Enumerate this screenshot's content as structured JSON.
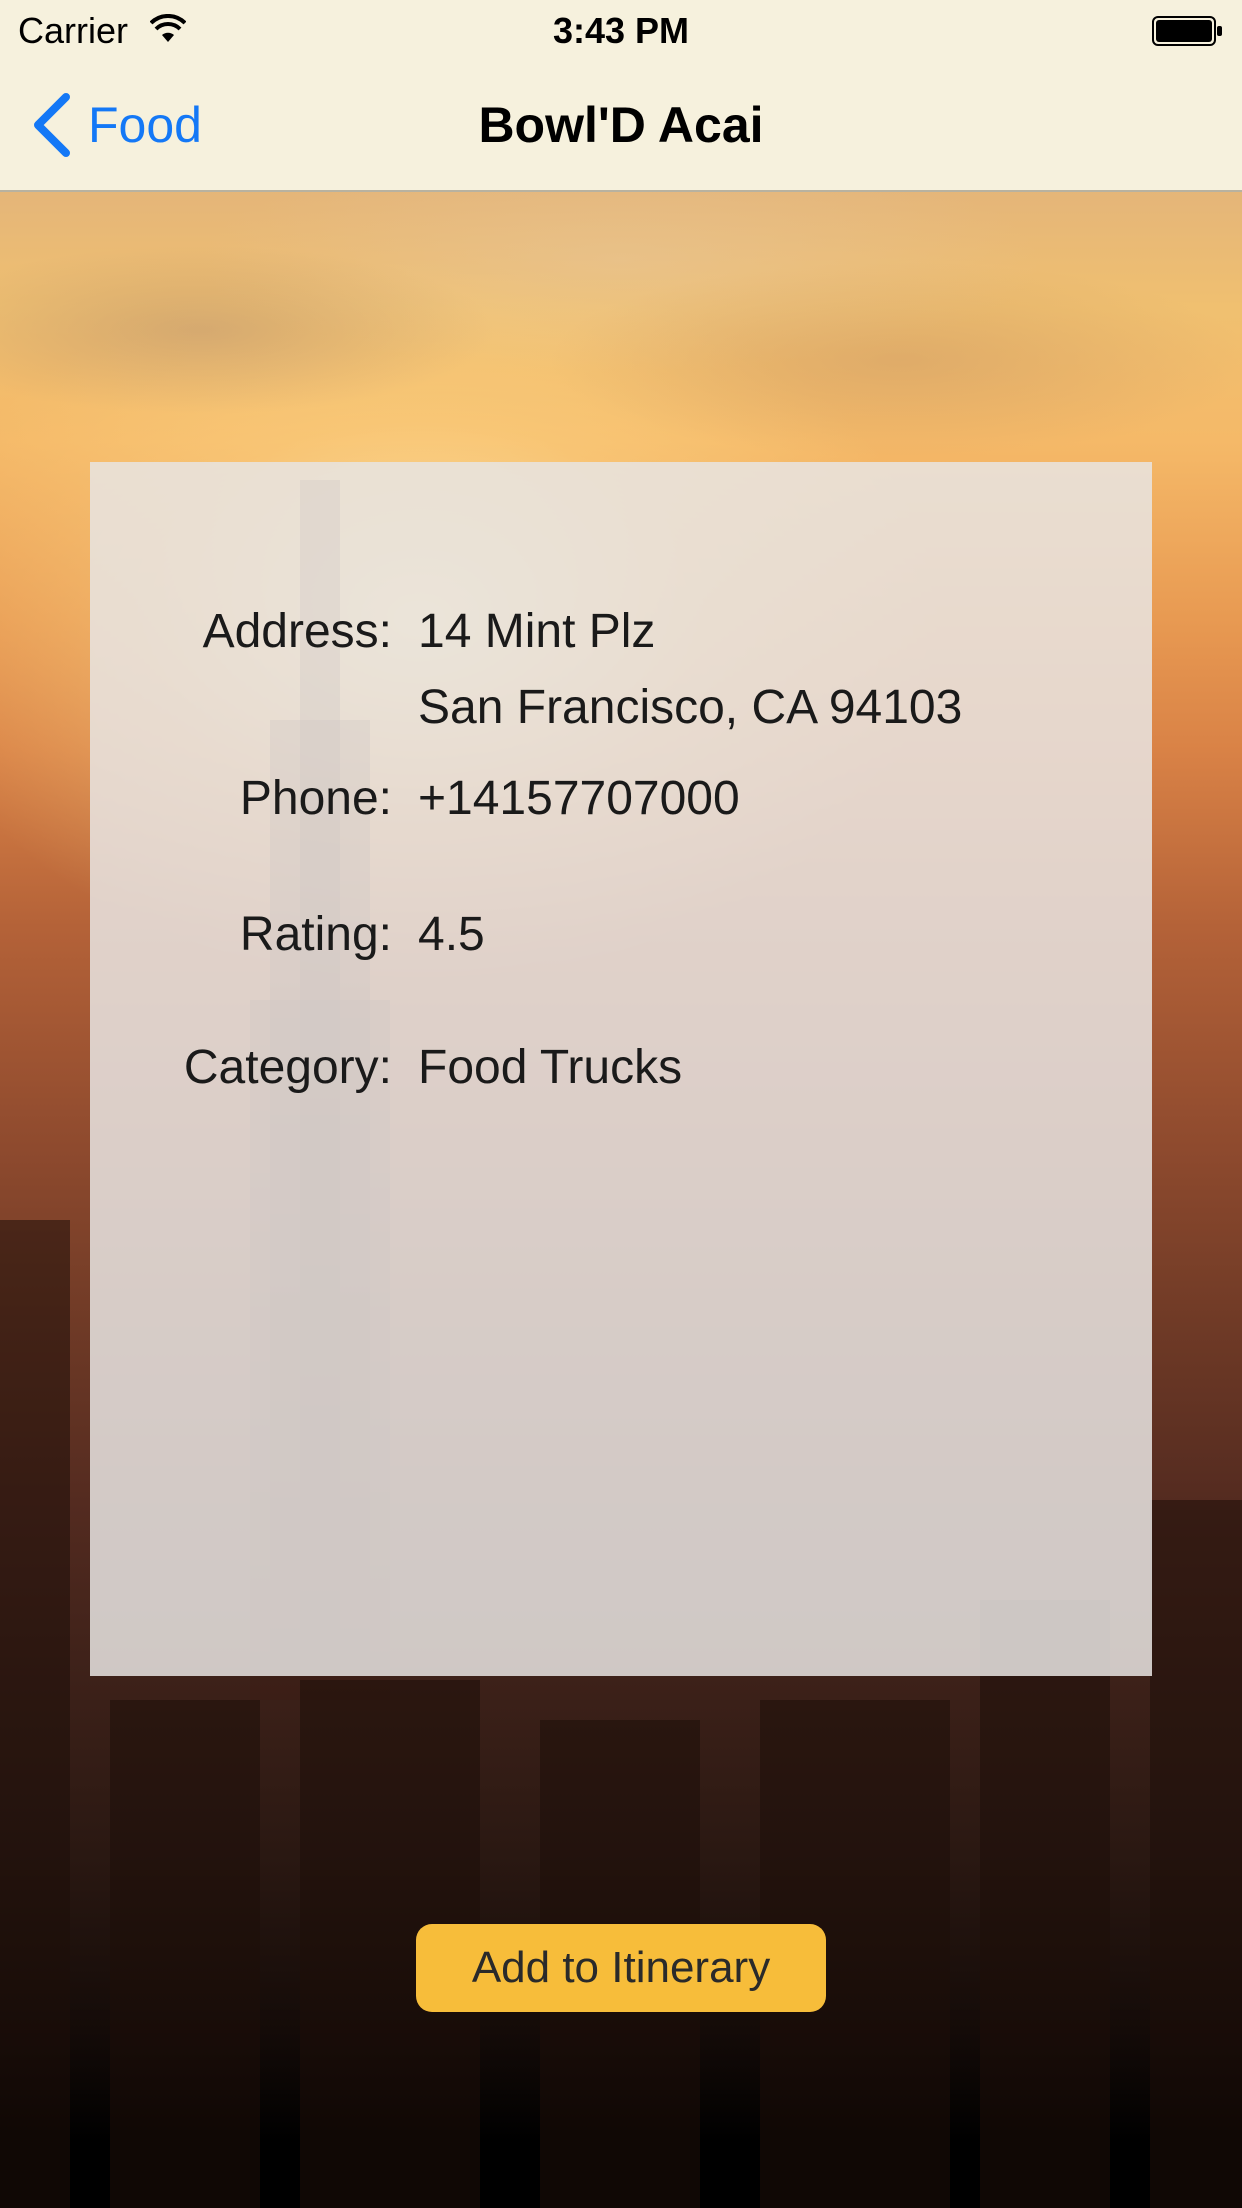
{
  "status_bar": {
    "carrier": "Carrier",
    "time": "3:43 PM",
    "icons": [
      "wifi-icon",
      "battery-icon"
    ]
  },
  "nav": {
    "back_label": "Food",
    "title": "Bowl'D Acai",
    "accent_color": "#1478f6"
  },
  "details": {
    "address_label": "Address:",
    "address_line1": "14 Mint Plz",
    "address_line2": "San Francisco, CA 94103",
    "phone_label": "Phone:",
    "phone": "+14157707000",
    "rating_label": "Rating:",
    "rating": "4.5",
    "category_label": "Category:",
    "category": "Food Trucks"
  },
  "actions": {
    "add_label": "Add to Itinerary",
    "button_color": "#f7bd3a"
  }
}
